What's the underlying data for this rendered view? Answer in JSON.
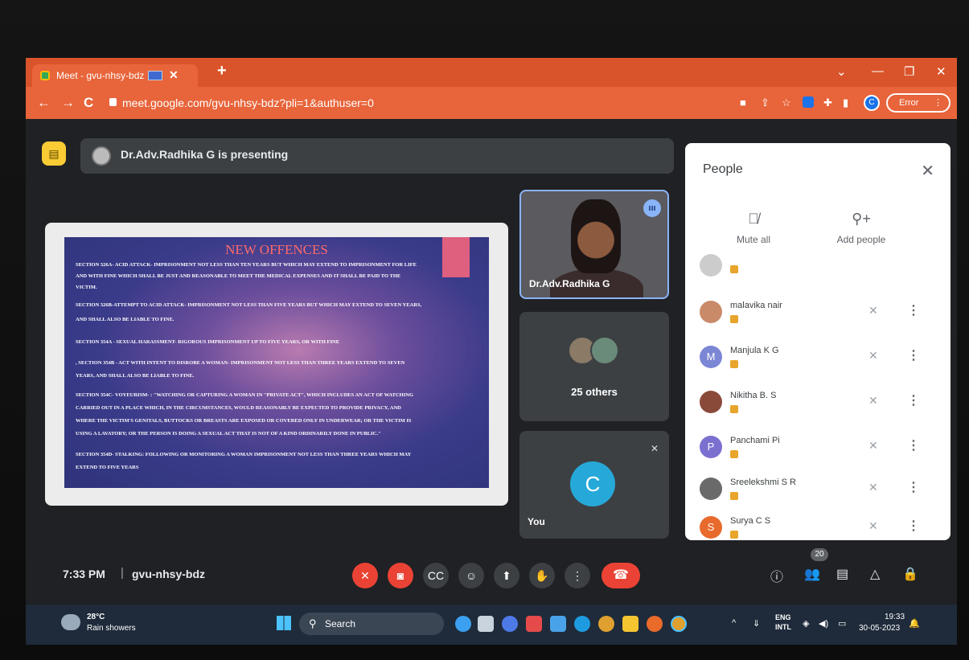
{
  "browser": {
    "tab_title": "Meet - gvu-nhsy-bdz",
    "url": "meet.google.com/gvu-nhsy-bdz?pli=1&authuser=0",
    "error_label": "Error",
    "profile_initial": "C"
  },
  "meet": {
    "presenting_banner": "Dr.Adv.Radhika G is presenting",
    "slide": {
      "title": "NEW OFFENCES",
      "lines": [
        "SECTION 326A- ACID ATTACK- IMPRISONMENT NOT LESS THAN TEN YEARS BUT WHICH MAY EXTEND TO IMPRISONMENT FOR LIFE",
        "AND WITH FINE WHICH SHALL BE JUST AND REASONABLE TO MEET THE MEDICAL EXPENSES AND IT SHALL BE PAID TO THE",
        "VICTIM.",
        "SECTION 326B-ATTEMPT TO ACID ATTACK- IMPRISONMENT NOT LESS THAN FIVE YEARS BUT WHICH MAY EXTEND TO SEVEN YEARS,",
        "AND SHALL ALSO BE LIABLE TO FINE.",
        "SECTION 354A - SEXUAL HARASSMENT- RIGOROUS IMPRISONMENT UP TO FIVE YEARS, OR WITH FINE",
        ", SECTION 354B - ACT WITH INTENT TO DISROBE A WOMAN- IMPRISONMENT NOT LESS THAN THREE YEARS EXTEND TO SEVEN",
        "YEARS, AND SHALL ALSO BE LIABLE TO FINE.",
        "SECTION 354C- VOYEURISM- : \"WATCHING OR CAPTURING A WOMAN IN \"PRIVATE ACT\", WHICH INCLUDES AN ACT OF WATCHING",
        "CARRIED OUT IN A PLACE WHICH, IN THE CIRCUMSTANCES, WOULD REASONABLY BE EXPECTED TO PROVIDE PRIVACY, AND",
        "WHERE THE VICTIM'S GENITALS, BUTTOCKS OR BREASTS ARE EXPOSED OR COVERED ONLY IN UNDERWEAR; OR THE VICTIM IS",
        "USING A LAVATORY; OR THE PERSON IS DOING A SEXUAL ACT THAT IS NOT OF A KIND ORDINARILY DONE IN PUBLIC.\"",
        "SECTION 354D- STALKING: FOLLOWING OR MONITORING A WOMAN   IMPRISONMENT NOT LESS THAN THREE YEARS WHICH MAY",
        "EXTEND TO FIVE YEARS"
      ]
    },
    "presenter_name": "Dr.Adv.Radhika G",
    "others_label": "25 others",
    "you_initial": "C",
    "you_label": "You"
  },
  "people_panel": {
    "title": "People",
    "mute_all": "Mute all",
    "add_people": "Add people",
    "participants": [
      {
        "name": "malavika nair",
        "initial": "",
        "color": "#c98a6a"
      },
      {
        "name": "Manjula K G",
        "initial": "M",
        "color": "#7b86d4"
      },
      {
        "name": "Nikitha B. S",
        "initial": "",
        "color": "#8a4a3a"
      },
      {
        "name": "Panchami Pi",
        "initial": "P",
        "color": "#7b6fd0"
      },
      {
        "name": "Sreelekshmi S R",
        "initial": "",
        "color": "#6a6a6a"
      },
      {
        "name": "Surya C S",
        "initial": "S",
        "color": "#e86a2c"
      }
    ]
  },
  "toolbar": {
    "time": "7:33 PM",
    "separator": "|",
    "meeting_code": "gvu-nhsy-bdz",
    "participant_count": "20"
  },
  "taskbar": {
    "temperature": "28°C",
    "weather": "Rain showers",
    "search_label": "Search",
    "lang_top": "ENG",
    "lang_bottom": "INTL",
    "clock_time": "19:33",
    "clock_date": "30-05-2023"
  },
  "colors": {
    "chrome_accent": "#d9542b",
    "meet_bg": "#202124",
    "end_call": "#ea4335",
    "presenting_accent": "#f9cb34"
  }
}
